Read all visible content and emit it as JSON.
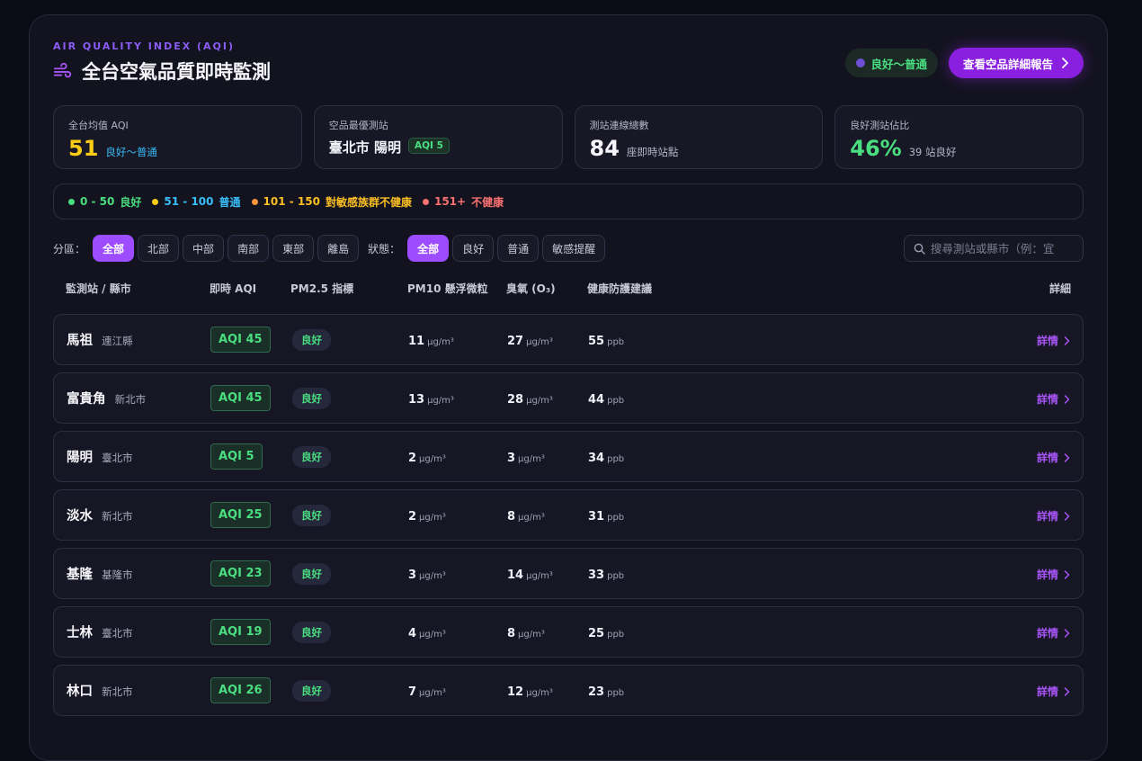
{
  "header": {
    "eyebrow": "AIR QUALITY INDEX (AQI)",
    "title": "全台空氣品質即時監測",
    "status": "良好～普通",
    "report_btn": "查看空品詳細報告"
  },
  "stats": {
    "avg": {
      "label": "全台均值 AQI",
      "value": "51",
      "sub": "良好～普通"
    },
    "best": {
      "label": "空品最優測站",
      "value": "臺北市 陽明",
      "badge": "AQI 5"
    },
    "total": {
      "label": "測站連線總數",
      "value": "84",
      "sub": "座即時站點"
    },
    "good": {
      "label": "良好測站佔比",
      "value": "46%",
      "sub": "39 站良好"
    }
  },
  "legend": [
    {
      "range": "0 - 50",
      "label": "良好"
    },
    {
      "range": "51 - 100",
      "label": "普通"
    },
    {
      "range": "101 - 150",
      "label": "對敏感族群不健康"
    },
    {
      "range": "151+",
      "label": "不健康"
    }
  ],
  "colors": {
    "good": "#4ade80",
    "moderate": "#facc15",
    "sensitive": "#fb923c",
    "unhealthy": "#f87171",
    "accent": "#9d4dff"
  },
  "filters": {
    "region_label": "分區：",
    "regions": [
      "全部",
      "北部",
      "中部",
      "南部",
      "東部",
      "離島"
    ],
    "status_label": "狀態：",
    "statuses": [
      "全部",
      "良好",
      "普通",
      "敏感提醒"
    ],
    "search_placeholder": "搜尋測站或縣市（例：宜"
  },
  "table": {
    "headers": [
      "監測站 / 縣市",
      "即時 AQI",
      "PM2.5 指標",
      "PM10 懸浮微粒",
      "臭氧 (O₃)",
      "健康防護建議",
      "詳細"
    ],
    "unit_ug": "μg/m³",
    "unit_ppb": "ppb",
    "detail_label": "詳情",
    "rows": [
      {
        "name": "馬祖",
        "county": "連江縣",
        "aqi": "AQI 45",
        "pm25": "良好",
        "pm10": "11",
        "o3": "27",
        "ppb": "55"
      },
      {
        "name": "富貴角",
        "county": "新北市",
        "aqi": "AQI 45",
        "pm25": "良好",
        "pm10": "13",
        "o3": "28",
        "ppb": "44"
      },
      {
        "name": "陽明",
        "county": "臺北市",
        "aqi": "AQI 5",
        "pm25": "良好",
        "pm10": "2",
        "o3": "3",
        "ppb": "34"
      },
      {
        "name": "淡水",
        "county": "新北市",
        "aqi": "AQI 25",
        "pm25": "良好",
        "pm10": "2",
        "o3": "8",
        "ppb": "31"
      },
      {
        "name": "基隆",
        "county": "基隆市",
        "aqi": "AQI 23",
        "pm25": "良好",
        "pm10": "3",
        "o3": "14",
        "ppb": "33"
      },
      {
        "name": "士林",
        "county": "臺北市",
        "aqi": "AQI 19",
        "pm25": "良好",
        "pm10": "4",
        "o3": "8",
        "ppb": "25"
      },
      {
        "name": "林口",
        "county": "新北市",
        "aqi": "AQI 26",
        "pm25": "良好",
        "pm10": "7",
        "o3": "12",
        "ppb": "23"
      }
    ]
  }
}
